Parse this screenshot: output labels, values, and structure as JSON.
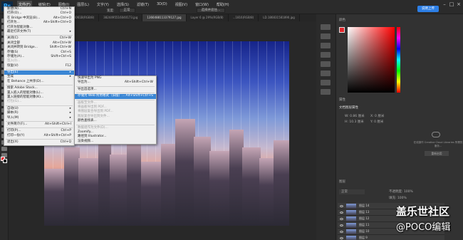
{
  "app": {
    "logo": "Ps"
  },
  "menubar": {
    "items": [
      "文件(F)",
      "编辑(E)",
      "图像(I)",
      "图层(L)",
      "文字(Y)",
      "选择(S)",
      "滤镜(T)",
      "3D(D)",
      "视图(V)",
      "窗口(W)",
      "帮助(H)"
    ],
    "cloud_button": "说明上传"
  },
  "options": {
    "width_label": "宽度:",
    "mode_value": "正常",
    "mask_button": "选择并遮住..."
  },
  "tabs": [
    "...ps9.jpg @ 33.3%",
    "4465697120061B(RGB/8)",
    "3824495516040173.jpg",
    "1366488113379127.jpg",
    "Layer 6 @ 29%(RGB/8)",
    "...1816(RGB/8)",
    "LD.186831581890.jpg"
  ],
  "file_menu": [
    {
      "label": "新建(N)...",
      "shortcut": "Ctrl+N"
    },
    {
      "label": "打开(O)...",
      "shortcut": "Ctrl+O"
    },
    {
      "label": "在 Bridge 中浏览(B)...",
      "shortcut": "Alt+Ctrl+O"
    },
    {
      "label": "打开为...",
      "shortcut": "Alt+Shift+Ctrl+O"
    },
    {
      "label": "打开为智能对象...",
      "shortcut": ""
    },
    {
      "label": "最近打开文件(T)",
      "shortcut": "▸"
    },
    {
      "sep": true
    },
    {
      "label": "关闭(C)",
      "shortcut": "Ctrl+W"
    },
    {
      "label": "关闭全部",
      "shortcut": "Alt+Ctrl+W"
    },
    {
      "label": "关闭并转到 Bridge...",
      "shortcut": "Shift+Ctrl+W"
    },
    {
      "label": "存储(S)",
      "shortcut": "Ctrl+S"
    },
    {
      "label": "存储为(A)...",
      "shortcut": "Shift+Ctrl+S"
    },
    {
      "label": "签入(I)...",
      "shortcut": "",
      "disabled": true
    },
    {
      "label": "恢复(V)",
      "shortcut": "F12"
    },
    {
      "sep": true
    },
    {
      "label": "导出(E)",
      "shortcut": "▸",
      "highlight": true
    },
    {
      "label": "生成",
      "shortcut": "▸"
    },
    {
      "label": "在 Behance 上共享(D)...",
      "shortcut": ""
    },
    {
      "sep": true
    },
    {
      "label": "搜索 Adobe Stock...",
      "shortcut": ""
    },
    {
      "label": "置入嵌入的智能对象(L)...",
      "shortcut": ""
    },
    {
      "label": "置入链接的智能对象(K)...",
      "shortcut": ""
    },
    {
      "label": "打包(G)...",
      "shortcut": "",
      "disabled": true
    },
    {
      "sep": true
    },
    {
      "label": "自动(U)",
      "shortcut": "▸"
    },
    {
      "label": "脚本(R)",
      "shortcut": "▸"
    },
    {
      "label": "导入(M)",
      "shortcut": "▸"
    },
    {
      "sep": true
    },
    {
      "label": "文件简介(F)...",
      "shortcut": "Alt+Shift+Ctrl+I"
    },
    {
      "sep": true
    },
    {
      "label": "打印(P)...",
      "shortcut": "Ctrl+P"
    },
    {
      "label": "打印一份(Y)",
      "shortcut": "Alt+Shift+Ctrl+P"
    },
    {
      "sep": true
    },
    {
      "label": "退出(X)",
      "shortcut": "Ctrl+Q"
    }
  ],
  "export_menu": [
    {
      "label": "快速导出为 PNG",
      "shortcut": ""
    },
    {
      "label": "导出为...",
      "shortcut": "Alt+Shift+Ctrl+W"
    },
    {
      "sep": true
    },
    {
      "label": "导出首选项...",
      "shortcut": ""
    },
    {
      "sep": true
    },
    {
      "label": "存储为 Web 所用格式（旧版）...",
      "shortcut": "Alt+Shift+Ctrl+S",
      "highlight": true
    },
    {
      "sep": true
    },
    {
      "label": "画板至文件...",
      "shortcut": "",
      "disabled": true
    },
    {
      "label": "将画板导出到 PDF...",
      "shortcut": "",
      "disabled": true
    },
    {
      "label": "将图层复合导出到 PDF...",
      "shortcut": "",
      "disabled": true
    },
    {
      "label": "图层复合导出到文件...",
      "shortcut": "",
      "disabled": true
    },
    {
      "label": "颜色查找表...",
      "shortcut": ""
    },
    {
      "sep": true
    },
    {
      "label": "数据组作为文件(D)...",
      "shortcut": "",
      "disabled": true
    },
    {
      "label": "Zoomify...",
      "shortcut": ""
    },
    {
      "label": "路径到 Illustrator...",
      "shortcut": ""
    },
    {
      "label": "渲染视频...",
      "shortcut": ""
    }
  ],
  "panels": {
    "color_tab": "颜色",
    "properties_tab": "属性",
    "properties_title": "文档图层属性",
    "w_label": "W: 0.86 厘米",
    "h_label": "H: 10.3 厘米",
    "x_label": "X: 0 厘米",
    "y_label": "Y: 0 厘米",
    "libraries_msg": "在线操作 Creative Cloud Libraries 所需的服务...",
    "libraries_button": "重新启用",
    "layers_tab": "图层",
    "blend_mode": "正常",
    "opacity": "不透明度: 100%",
    "fill": "填充: 100%",
    "layers": [
      "图层 14",
      "图层 13",
      "图层 12",
      "图层 11",
      "图层 10",
      "图层 9"
    ]
  },
  "watermark": {
    "line1": "盖乐世社区",
    "line2": "@POCO编辑"
  },
  "colors": {
    "accent": "#3a86d4",
    "foreground": "#e0262b",
    "background": "#111111"
  }
}
